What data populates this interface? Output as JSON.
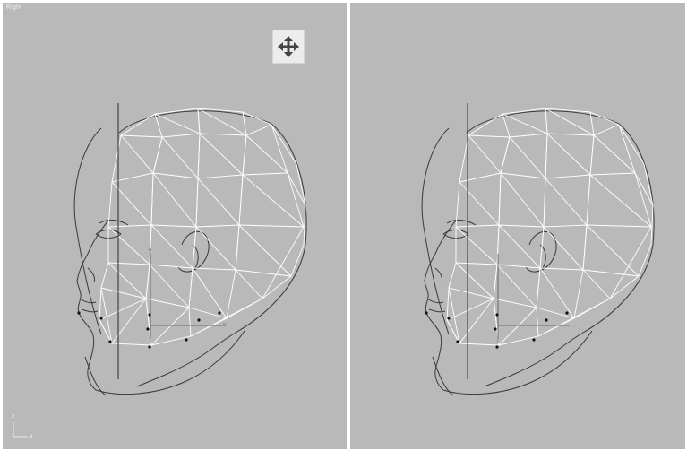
{
  "viewports": {
    "left": {
      "label": "Right"
    },
    "right": {
      "label": ""
    }
  },
  "tool": {
    "icon": "move-icon"
  },
  "axis_gizmo": {
    "z_label": "z",
    "y_label": "y"
  },
  "colors": {
    "viewport_bg": "#b9b9b9",
    "wire_highlight": "#ffffff",
    "wire_dark": "#3a3a3a",
    "vertex": "#111111"
  }
}
